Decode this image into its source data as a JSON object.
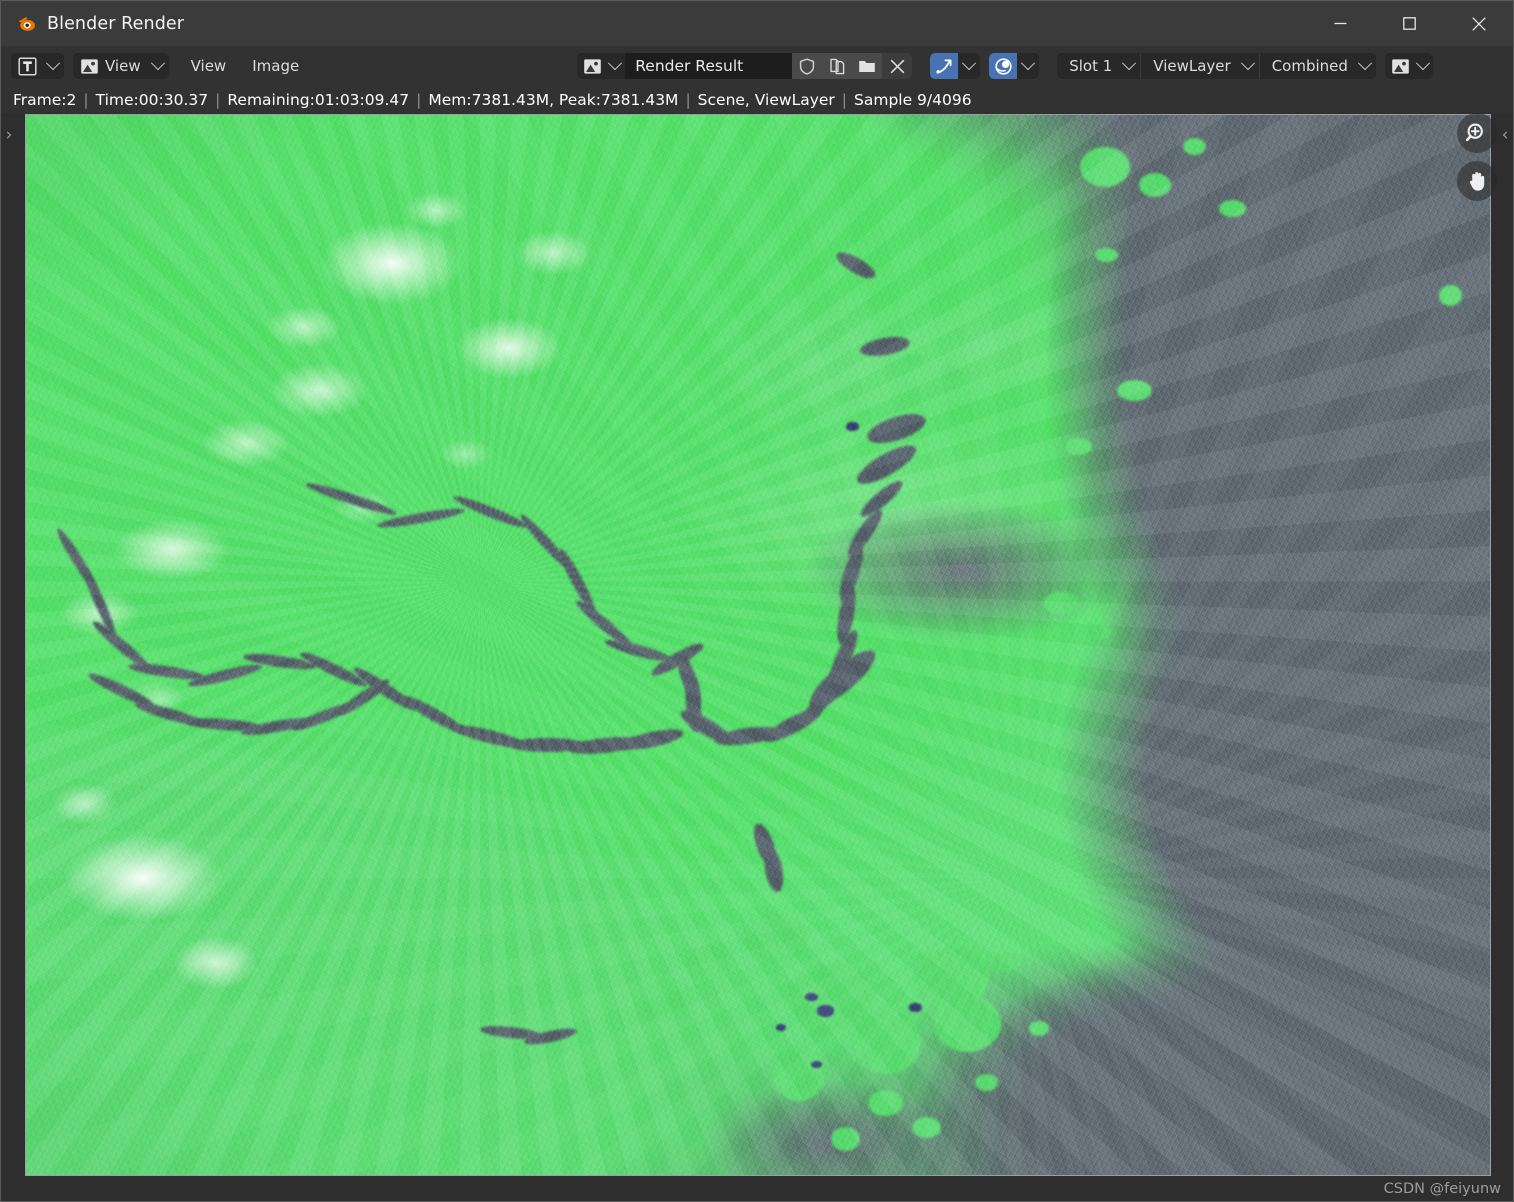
{
  "window": {
    "title": "Blender Render",
    "logo_icon": "blender-logo-icon",
    "minimize_icon": "minimize-icon",
    "maximize_icon": "maximize-icon",
    "close_icon": "close-icon"
  },
  "header": {
    "editor_type": {
      "icon": "image-editor-icon",
      "dropdown_icon": "chevron-down-icon"
    },
    "view_mode": {
      "icon": "image-icon",
      "label": "View",
      "dropdown_icon": "chevron-down-icon"
    },
    "menus": [
      {
        "label": "View"
      },
      {
        "label": "Image"
      }
    ],
    "image_block": {
      "browse_icon": "image-browse-icon",
      "browse_dropdown_icon": "chevron-down-icon",
      "name": "Render Result",
      "fake_user_icon": "shield-icon",
      "new_copy_icon": "copy-icon",
      "open_icon": "folder-icon",
      "unlink_icon": "x-icon"
    },
    "toggles": [
      {
        "name": "display-channels-toggle",
        "icon": "curve-arrow-icon",
        "active": true,
        "dropdown_icon": "chevron-down-icon"
      },
      {
        "name": "color-management-toggle",
        "icon": "sphere-icon",
        "active": true,
        "dropdown_icon": "chevron-down-icon"
      }
    ],
    "slot": {
      "label": "Slot 1",
      "dropdown_icon": "chevron-down-icon"
    },
    "viewlayer": {
      "label": "ViewLayer",
      "dropdown_icon": "chevron-down-icon"
    },
    "pass": {
      "label": "Combined",
      "dropdown_icon": "chevron-down-icon"
    },
    "display_mode": {
      "icon": "image-display-icon",
      "dropdown_icon": "chevron-down-icon"
    }
  },
  "status": {
    "segments": [
      "Frame:2",
      "Time:00:30.37",
      "Remaining:01:03:09.47",
      "Mem:7381.43M, Peak:7381.43M",
      "Scene, ViewLayer",
      "Sample 9/4096"
    ],
    "divider": "|",
    "frame": "Frame:2",
    "time": "Time:00:30.37",
    "remaining": "Remaining:01:03:09.47",
    "memory": "Mem:7381.43M, Peak:7381.43M",
    "scene": "Scene, ViewLayer",
    "sample": "Sample 9/4096"
  },
  "viewport": {
    "left_panel_arrow": "›",
    "right_panel_arrow": "‹",
    "gizmos": [
      {
        "name": "zoom-gizmo",
        "icon": "magnifier-plus-icon"
      },
      {
        "name": "pan-gizmo",
        "icon": "hand-icon"
      }
    ],
    "render_description": "Rendered terrain elevation map: green landmass with white high-elevation ridges, gray-blue ocean to the east, river delta and coastal archipelago",
    "colors": {
      "land_green": "#5ade6f",
      "land_green_light": "#7ae48c",
      "ocean_gray": "#667078",
      "river_gray": "#5a646e",
      "ridge_white": "#ffffff",
      "lake_purple": "#3b357a"
    }
  },
  "watermark": {
    "text": "CSDN @feiyunw"
  },
  "theme": {
    "titlebar_bg": "#3b3b3b",
    "header_bg": "#323232",
    "editor_bg": "#2e2e2e",
    "accent_blue": "#4772b3",
    "text_primary": "#ffffff",
    "field_bg": "#1d1d1d"
  }
}
